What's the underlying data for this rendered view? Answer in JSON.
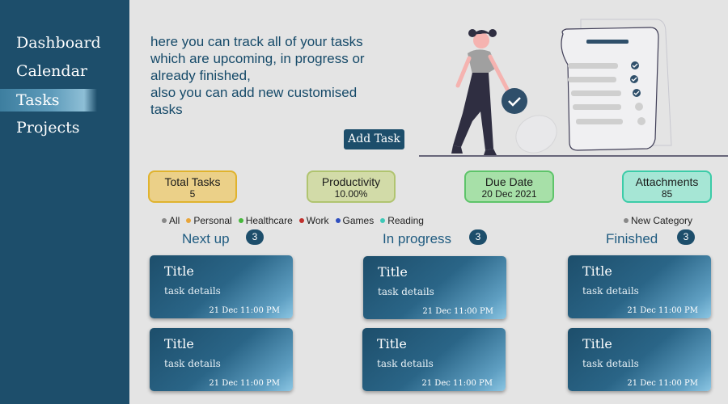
{
  "sidebar": {
    "items": [
      {
        "label": "Dashboard"
      },
      {
        "label": "Calendar"
      },
      {
        "label": "Tasks"
      },
      {
        "label": "Projects"
      }
    ]
  },
  "intro": {
    "lines": [
      "here you can track all of your tasks",
      "which are upcoming, in progress or",
      "already finished,",
      "also you can add new customised",
      "tasks"
    ]
  },
  "add_task_label": "Add Task",
  "stats": [
    {
      "label": "Total Tasks",
      "value": "5",
      "bg": "#ebd088",
      "border": "#e0b32e"
    },
    {
      "label": "Productivity",
      "value": "10.00%",
      "bg": "#d2dba8",
      "border": "#b0c470"
    },
    {
      "label": "Due Date",
      "value": "20 Dec 2021",
      "bg": "#a7e0a8",
      "border": "#5ec46a"
    },
    {
      "label": "Attachments",
      "value": "85",
      "bg": "#a6e6d5",
      "border": "#3ccca8"
    }
  ],
  "categories": [
    {
      "label": "All",
      "color": "#888888"
    },
    {
      "label": "Personal",
      "color": "#e8a53a"
    },
    {
      "label": "Healthcare",
      "color": "#46b83a"
    },
    {
      "label": "Work",
      "color": "#c0302c"
    },
    {
      "label": "Games",
      "color": "#2f4fbf"
    },
    {
      "label": "Reading",
      "color": "#3ec9b8"
    }
  ],
  "new_category": {
    "label": "New Category",
    "color": "#888888"
  },
  "columns": [
    {
      "title": "Next up",
      "count": "3"
    },
    {
      "title": "In progress",
      "count": "3"
    },
    {
      "title": "Finished",
      "count": "3"
    }
  ],
  "card": {
    "title": "Title",
    "details": "task details",
    "date": "21 Dec 11:00 PM"
  }
}
